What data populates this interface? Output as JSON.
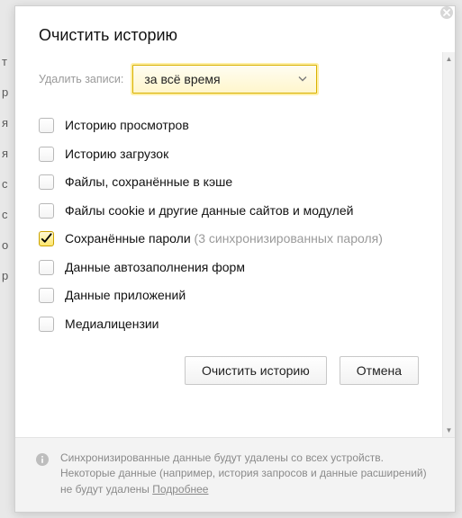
{
  "title": "Очистить историю",
  "period": {
    "label": "Удалить записи:",
    "selected": "за всё время"
  },
  "options": [
    {
      "label": "Историю просмотров",
      "checked": false
    },
    {
      "label": "Историю загрузок",
      "checked": false
    },
    {
      "label": "Файлы, сохранённые в кэше",
      "checked": false
    },
    {
      "label": "Файлы cookie и другие данные сайтов и модулей",
      "checked": false
    },
    {
      "label": "Сохранённые пароли",
      "sub": " (3 синхронизированных пароля)",
      "checked": true
    },
    {
      "label": "Данные автозаполнения форм",
      "checked": false
    },
    {
      "label": "Данные приложений",
      "checked": false
    },
    {
      "label": "Медиалицензии",
      "checked": false
    }
  ],
  "buttons": {
    "clear": "Очистить историю",
    "cancel": "Отмена"
  },
  "footer": {
    "text": "Синхронизированные данные будут удалены со всех устройств. Некоторые данные (например, история запросов и данные расширений) не будут удалены ",
    "link": "Подробнее"
  },
  "bg_letters": [
    "т",
    "р",
    "я",
    "я",
    "с",
    "с",
    "",
    "о",
    "",
    "",
    "",
    "р"
  ]
}
